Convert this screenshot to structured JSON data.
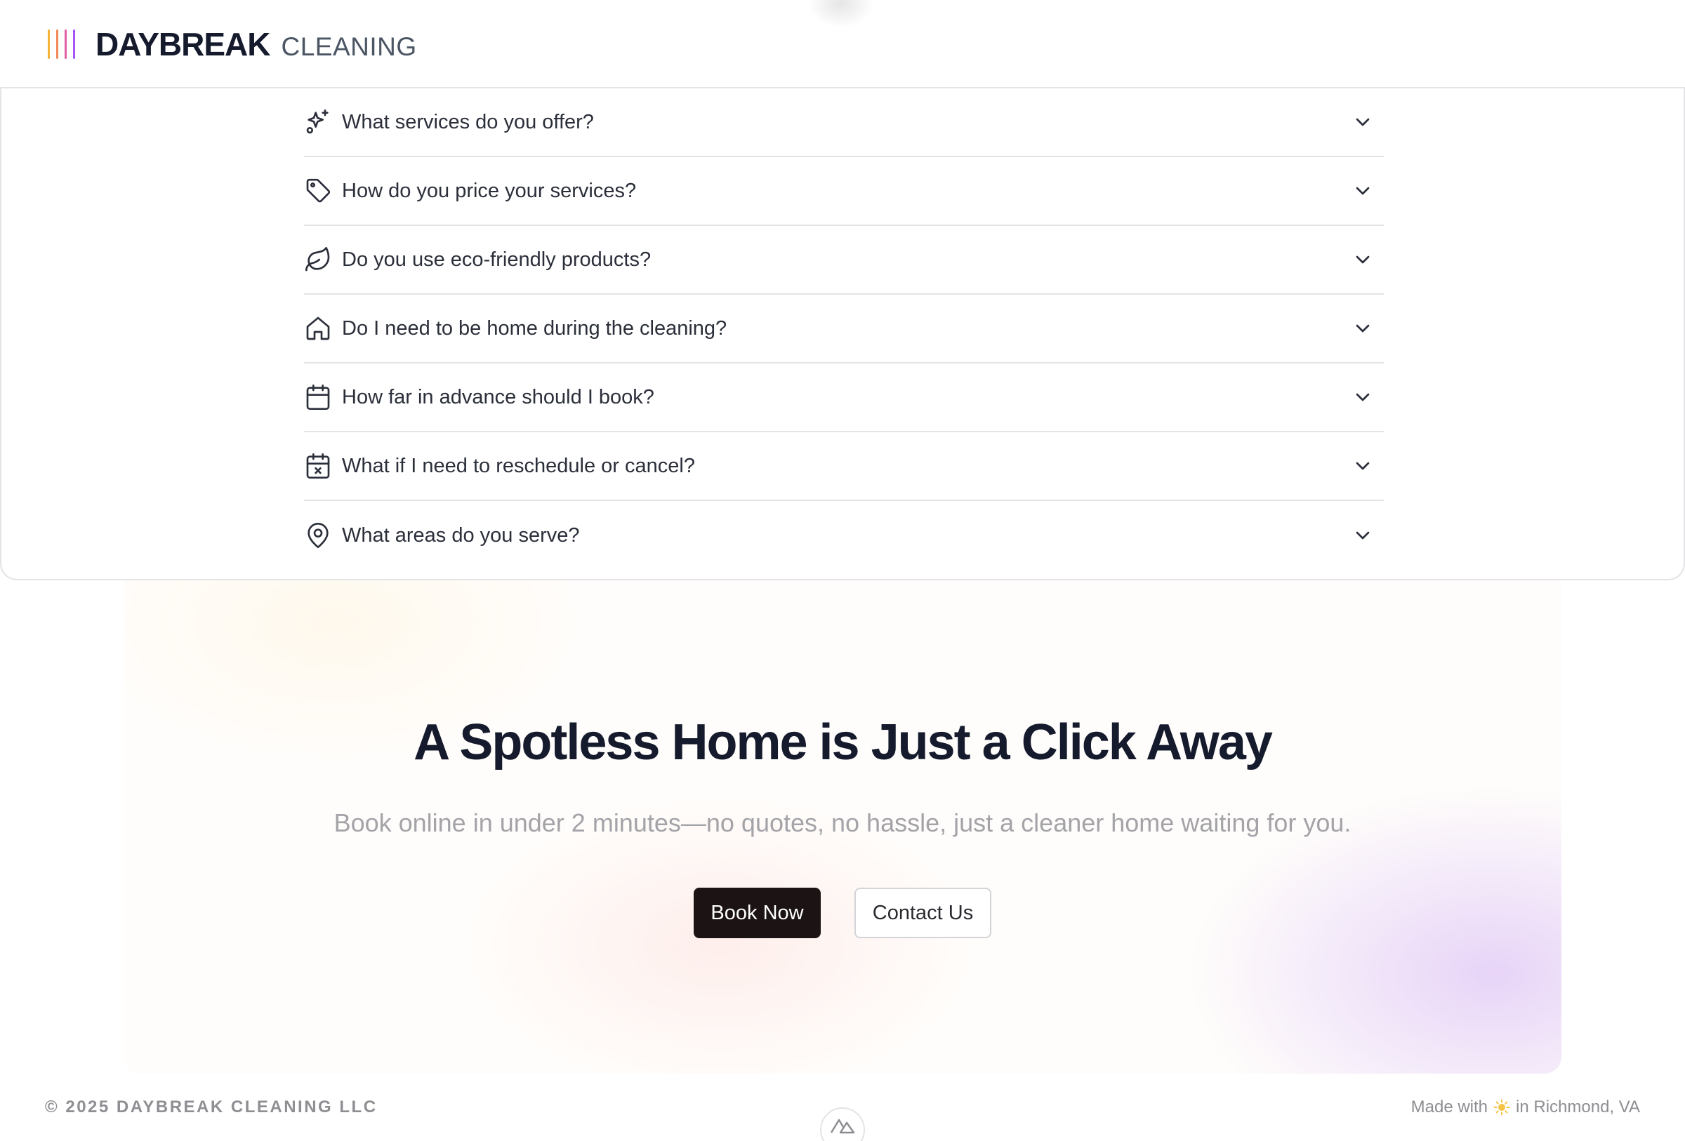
{
  "header": {
    "brand_main": "DAYBREAK",
    "brand_sub": "CLEANING",
    "logo_colors": [
      "#f5b43c",
      "#f28a5c",
      "#e25fa6",
      "#a855f7"
    ]
  },
  "faq": {
    "items": [
      {
        "icon": "sparkles-icon",
        "question": "What services do you offer?"
      },
      {
        "icon": "tag-icon",
        "question": "How do you price your services?"
      },
      {
        "icon": "leaf-icon",
        "question": "Do you use eco-friendly products?"
      },
      {
        "icon": "home-icon",
        "question": "Do I need to be home during the cleaning?"
      },
      {
        "icon": "calendar-icon",
        "question": "How far in advance should I book?"
      },
      {
        "icon": "calendar-x-icon",
        "question": "What if I need to reschedule or cancel?"
      },
      {
        "icon": "map-pin-icon",
        "question": "What areas do you serve?"
      }
    ]
  },
  "cta": {
    "title": "A Spotless Home is Just a Click Away",
    "subtitle": "Book online in under 2 minutes—no quotes, no hassle, just a cleaner home waiting for you.",
    "book_label": "Book Now",
    "contact_label": "Contact Us"
  },
  "footer": {
    "copyright": "© 2025 DAYBREAK CLEANING LLC",
    "made_with": "Made with",
    "location": "in Richmond, VA"
  },
  "colors": {
    "text_dark": "#151a2d",
    "book_bg": "#1c1414",
    "muted": "#8e8e93"
  }
}
